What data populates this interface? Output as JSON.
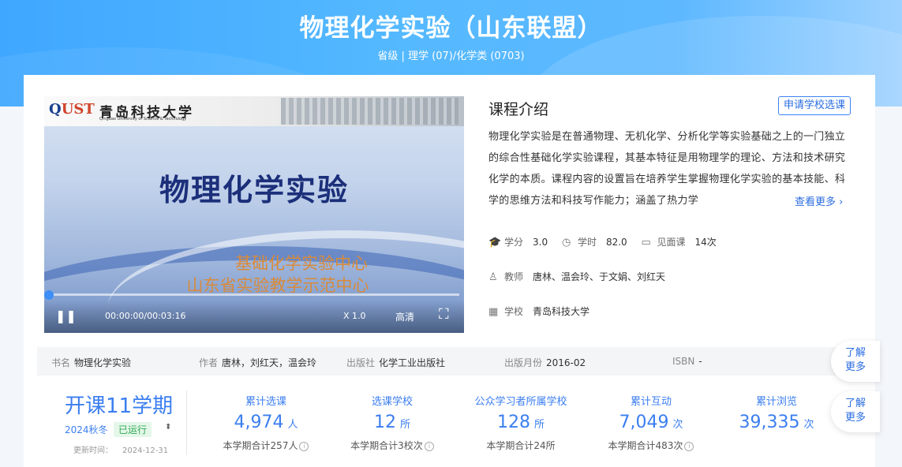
{
  "header": {
    "title": "物理化学实验（山东联盟）",
    "subtitle": "省级 | 理学 (07)/化学类 (0703)"
  },
  "video": {
    "logo_text": "QUST",
    "university_cn": "青岛科技大学",
    "university_en": "Qingdao University of Science & Technology",
    "slide_title": "物理化学实验",
    "slide_line1": "基础化学实验中心",
    "slide_line2": "山东省实验教学示范中心",
    "time": "00:00:00/00:03:16",
    "speed": "X 1.0",
    "quality": "高清",
    "progress": 0
  },
  "intro": {
    "title": "课程介绍",
    "apply_button": "申请学校选课",
    "text": "物理化学实验是在普通物理、无机化学、分析化学等实验基础之上的一门独立的综合性基础化学实验课程，其基本特征是用物理学的理论、方法和技术研究化学的本质。课程内容的设置旨在培养学生掌握物理化学实验的基本技能、科学的思维方法和科技写作能力；涵盖了热力学",
    "more": "查看更多"
  },
  "meta": {
    "credit_label": "学分",
    "credit": "3.0",
    "hours_label": "学时",
    "hours": "82.0",
    "meeting_label": "见面课",
    "meeting": "14次",
    "teacher_label": "教师",
    "teachers": "唐林、温会玲、于文娟、刘红天",
    "school_label": "学校",
    "school": "青岛科技大学"
  },
  "book": {
    "name_label": "书名",
    "name": "物理化学实验",
    "author_label": "作者",
    "author": "唐林，刘红天，温会玲",
    "publisher_label": "出版社",
    "publisher": "化学工业出版社",
    "date_label": "出版月份",
    "date": "2016-02",
    "isbn_label": "ISBN",
    "isbn": "-"
  },
  "term": {
    "title": "开课11学期",
    "season": "2024秋冬",
    "status": "已运行",
    "update_label": "更新时间：",
    "update_date": "2024-12-31"
  },
  "stats": [
    {
      "label": "累计选课",
      "value": "4,974",
      "unit": "人",
      "sub": "本学期合计257人"
    },
    {
      "label": "选课学校",
      "value": "12",
      "unit": "所",
      "sub": "本学期合计3校次"
    },
    {
      "label": "公众学习者所属学校",
      "value": "128",
      "unit": "所",
      "sub": "本学期合计24所"
    },
    {
      "label": "累计互动",
      "value": "7,049",
      "unit": "次",
      "sub": "本学期合计483次"
    },
    {
      "label": "累计浏览",
      "value": "39,335",
      "unit": "次",
      "sub": ""
    }
  ],
  "float": {
    "learn_more_1": "了解更多",
    "learn_more_2": "了解更多"
  }
}
